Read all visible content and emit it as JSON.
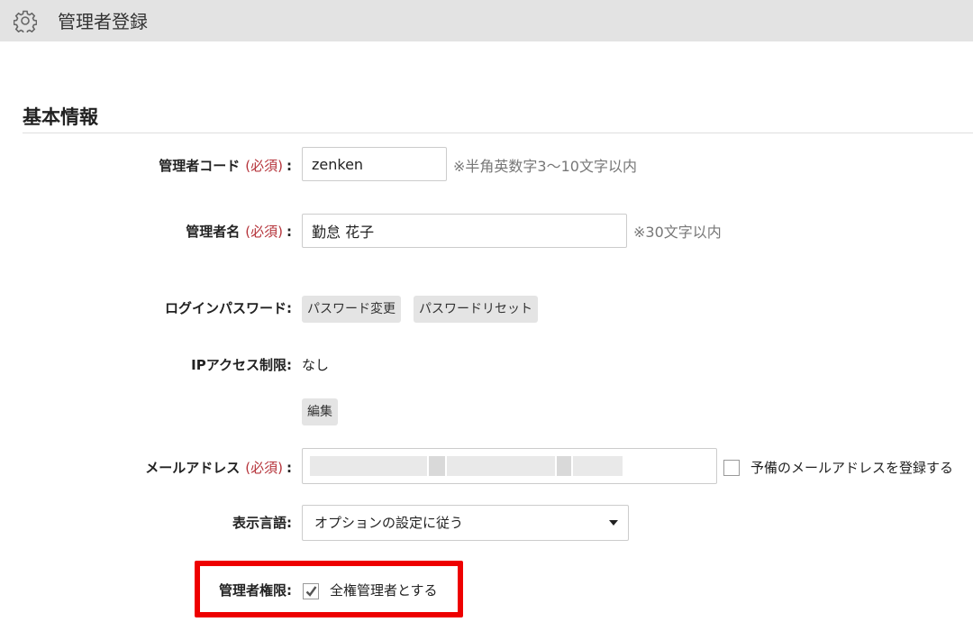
{
  "header": {
    "title": "管理者登録",
    "icon": "gear-icon"
  },
  "section": {
    "title": "基本情報"
  },
  "form": {
    "required_text": "(必須)",
    "admin_code": {
      "label": "管理者コード",
      "value": "zenken",
      "hint": "※半角英数字3～10文字以内"
    },
    "admin_name": {
      "label": "管理者名",
      "value": "勤怠 花子",
      "hint": "※30文字以内"
    },
    "password": {
      "label": "ログインパスワード:",
      "change_label": "パスワード変更",
      "reset_label": "パスワードリセット"
    },
    "ip_access": {
      "label": "IPアクセス制限:",
      "value": "なし",
      "edit_label": "編集"
    },
    "email": {
      "label": "メールアドレス",
      "value_redacted": true,
      "backup_label": "予備のメールアドレスを登録する",
      "backup_checked": false
    },
    "language": {
      "label": "表示言語:",
      "selected": "オプションの設定に従う"
    },
    "authority": {
      "label": "管理者権限:",
      "option_label": "全権管理者とする",
      "checked": true
    }
  },
  "colors": {
    "required": "#b5333a",
    "highlight": "#ee0000",
    "header_bg": "#e3e3e3"
  }
}
